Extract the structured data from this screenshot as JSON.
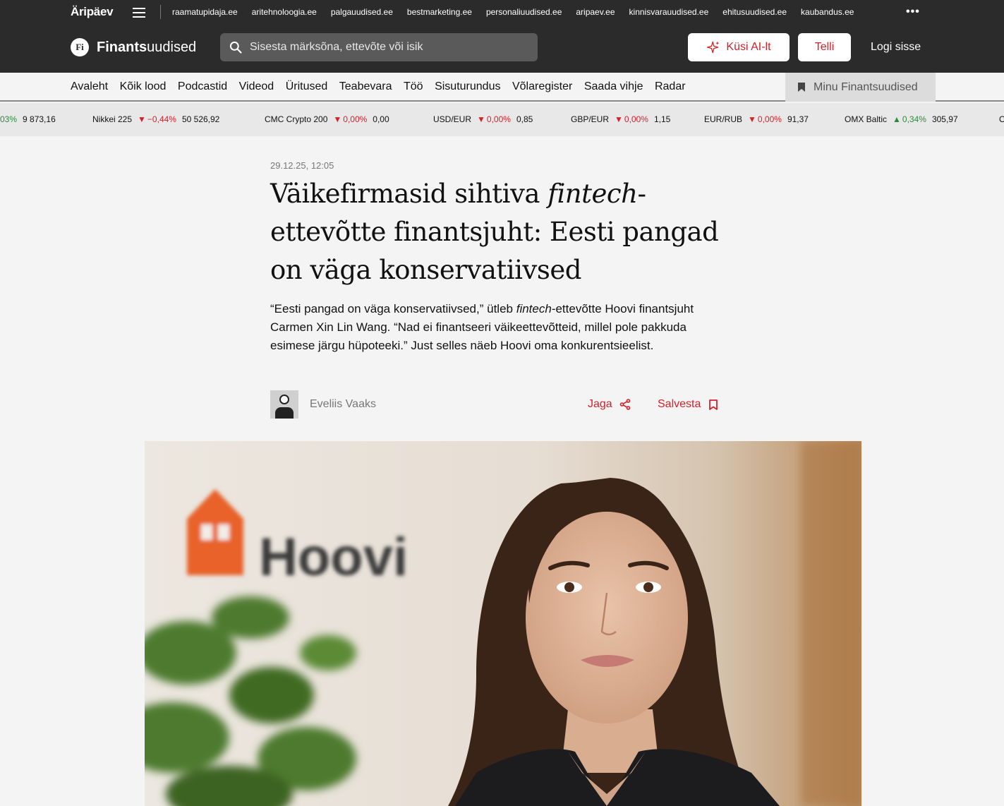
{
  "network": {
    "brand": "Äripäev",
    "links": [
      "raamatupidaja.ee",
      "aritehnoloogia.ee",
      "palgauudised.ee",
      "bestmarketing.ee",
      "personaliuudised.ee",
      "aripaev.ee",
      "kinnisvarauudised.ee",
      "ehitusuudised.ee",
      "kaubandus.ee"
    ],
    "more": "•••"
  },
  "header": {
    "logo_mark": "Fi",
    "logo_bold": "Finants",
    "logo_light": "uudised",
    "search_placeholder": "Sisesta märksõna, ettevõte või isik",
    "ai_button": "Küsi AI-lt",
    "subscribe_button": "Telli",
    "login": "Logi sisse"
  },
  "nav": {
    "items": [
      "Avaleht",
      "Kõik lood",
      "Podcastid",
      "Videod",
      "Üritused",
      "Teabevara",
      "Töö",
      "Sisuturundus",
      "Võlaregister",
      "Saada vihje",
      "Radar"
    ],
    "my": "Minu Finantsuudised"
  },
  "ticker": [
    {
      "name": "",
      "change": "03%",
      "value": "9 873,16",
      "dir": "up"
    },
    {
      "name": "Nikkei 225",
      "change": "−0,44%",
      "value": "50 526,92",
      "dir": "down"
    },
    {
      "name": "CMC Crypto 200",
      "change": "0,00%",
      "value": "0,00",
      "dir": "down"
    },
    {
      "name": "USD/EUR",
      "change": "0,00%",
      "value": "0,85",
      "dir": "down"
    },
    {
      "name": "GBP/EUR",
      "change": "0,00%",
      "value": "1,15",
      "dir": "down"
    },
    {
      "name": "EUR/RUB",
      "change": "0,00%",
      "value": "91,37",
      "dir": "down"
    },
    {
      "name": "OMX Baltic",
      "change": "0,34%",
      "value": "305,97",
      "dir": "up"
    },
    {
      "name": "O",
      "change": "",
      "value": "",
      "dir": ""
    }
  ],
  "article": {
    "date": "29.12.25, 12:05",
    "title_pre": "Väikefirmasid sihtiva ",
    "title_italic": "fintech",
    "title_post": "-ettevõtte finantsjuht: Eesti pangad on väga konservatiivsed",
    "lead_pre": "“Eesti pangad on väga konservatiivsed,” ütleb ",
    "lead_italic": "fintech",
    "lead_post": "-ettevõtte Hoovi finantsjuht Carmen Xin Lin Wang. “Nad ei finantseeri väikeettevõtteid, millel pole pakkuda esimese järgu hüpoteeki.” Just selles näeb Hoovi oma konkurentsieelist.",
    "author": "Eveliis Vaaks",
    "share": "Jaga",
    "save": "Salvesta",
    "hero_sign": "Hoovi"
  },
  "colors": {
    "accent": "#d6202a",
    "dark": "#2b2b2b",
    "up": "#2c8a3e"
  }
}
